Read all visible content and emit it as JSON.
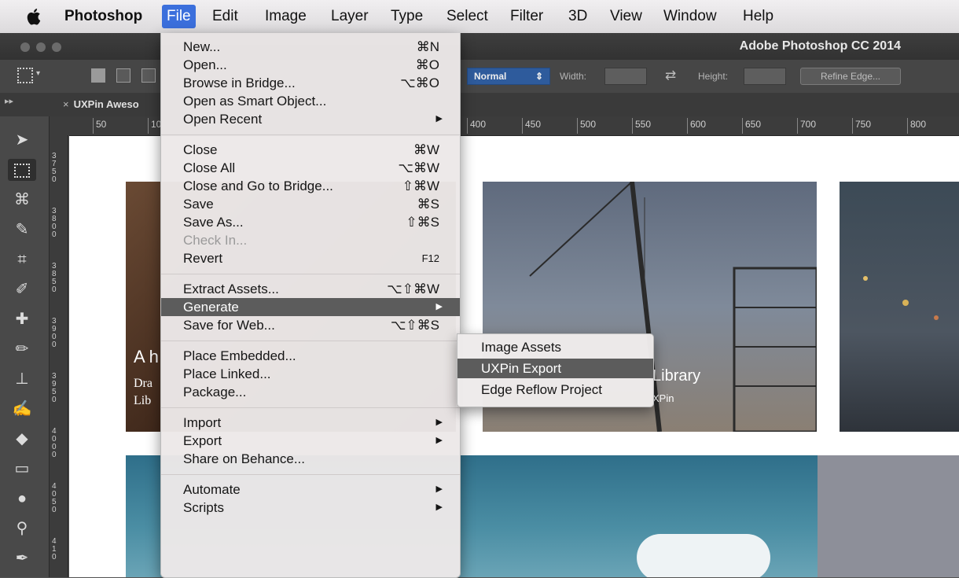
{
  "menubar": {
    "app": "Photoshop",
    "items": [
      "File",
      "Edit",
      "Image",
      "Layer",
      "Type",
      "Select",
      "Filter",
      "3D",
      "View",
      "Window",
      "Help"
    ]
  },
  "window": {
    "title": "Adobe Photoshop CC 2014"
  },
  "options_bar": {
    "mode": "Normal",
    "width_label": "Width:",
    "height_label": "Height:",
    "refine_button": "Refine Edge..."
  },
  "document": {
    "tab_label": "UXPin Aweso",
    "close_glyph": "×"
  },
  "ruler": {
    "h_ticks": [
      "50",
      "10",
      "400",
      "450",
      "500",
      "550",
      "600",
      "650",
      "700",
      "750",
      "800"
    ],
    "v_ticks": [
      "3750",
      "3800",
      "3850",
      "3900",
      "3950",
      "4000",
      "4050",
      "410"
    ]
  },
  "canvas": {
    "card1_title": "A h",
    "card1_line1": "Dra",
    "card1_line2": "Lib",
    "card2_title": "Library",
    "card2_sub": "XPin"
  },
  "file_menu": {
    "items": [
      {
        "label": "New...",
        "shortcut": "⌘N"
      },
      {
        "label": "Open...",
        "shortcut": "⌘O"
      },
      {
        "label": "Browse in Bridge...",
        "shortcut": "⌥⌘O"
      },
      {
        "label": "Open as Smart Object...",
        "shortcut": ""
      },
      {
        "label": "Open Recent",
        "shortcut": "",
        "submenu": true
      },
      {
        "label": "Close",
        "shortcut": "⌘W"
      },
      {
        "label": "Close All",
        "shortcut": "⌥⌘W"
      },
      {
        "label": "Close and Go to Bridge...",
        "shortcut": "⇧⌘W"
      },
      {
        "label": "Save",
        "shortcut": "⌘S"
      },
      {
        "label": "Save As...",
        "shortcut": "⇧⌘S"
      },
      {
        "label": "Check In...",
        "shortcut": "",
        "disabled": true
      },
      {
        "label": "Revert",
        "shortcut": "F12"
      },
      {
        "label": "Extract Assets...",
        "shortcut": "⌥⇧⌘W"
      },
      {
        "label": "Generate",
        "shortcut": "",
        "submenu": true,
        "highlighted": true
      },
      {
        "label": "Save for Web...",
        "shortcut": "⌥⇧⌘S"
      },
      {
        "label": "Place Embedded...",
        "shortcut": ""
      },
      {
        "label": "Place Linked...",
        "shortcut": ""
      },
      {
        "label": "Package...",
        "shortcut": ""
      },
      {
        "label": "Import",
        "shortcut": "",
        "submenu": true
      },
      {
        "label": "Export",
        "shortcut": "",
        "submenu": true
      },
      {
        "label": "Share on Behance...",
        "shortcut": ""
      },
      {
        "label": "Automate",
        "shortcut": "",
        "submenu": true
      },
      {
        "label": "Scripts",
        "shortcut": "",
        "submenu": true
      }
    ]
  },
  "generate_submenu": {
    "items": [
      {
        "label": "Image Assets"
      },
      {
        "label": "UXPin Export",
        "highlighted": true
      },
      {
        "label": "Edge Reflow Project"
      }
    ]
  },
  "glyphs": {
    "submenu_arrow": "▶"
  }
}
